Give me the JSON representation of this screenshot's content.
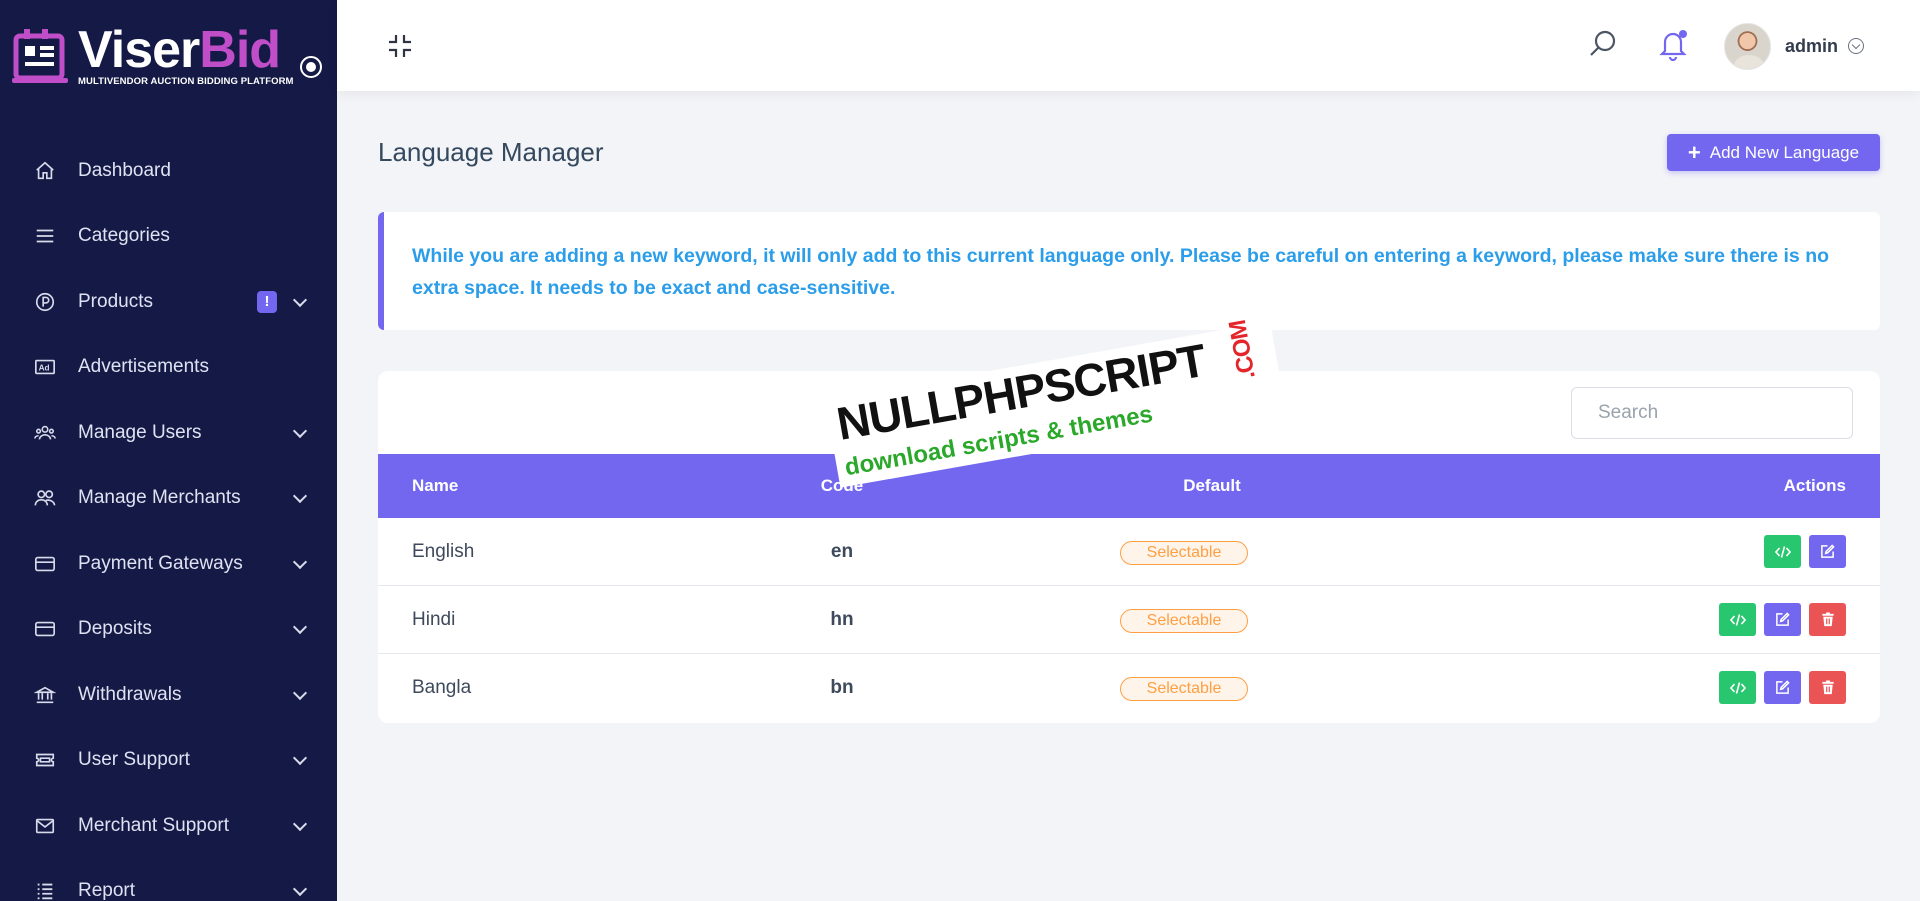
{
  "brand": {
    "name_part1": "Viser",
    "name_part2": "Bid",
    "tagline": "MULTIVENDOR AUCTION BIDDING PLATFORM"
  },
  "sidebar": {
    "items": [
      {
        "label": "Dashboard",
        "icon": "home-icon"
      },
      {
        "label": "Categories",
        "icon": "menu-lines-icon"
      },
      {
        "label": "Products",
        "icon": "p-circle-icon",
        "badge": "!"
      },
      {
        "label": "Advertisements",
        "icon": "ad-icon"
      },
      {
        "label": "Manage Users",
        "icon": "users-icon"
      },
      {
        "label": "Manage Merchants",
        "icon": "merchants-icon"
      },
      {
        "label": "Payment Gateways",
        "icon": "credit-card-icon"
      },
      {
        "label": "Deposits",
        "icon": "credit-card-icon"
      },
      {
        "label": "Withdrawals",
        "icon": "bank-icon"
      },
      {
        "label": "User Support",
        "icon": "ticket-icon"
      },
      {
        "label": "Merchant Support",
        "icon": "mail-icon"
      },
      {
        "label": "Report",
        "icon": "list-icon"
      }
    ]
  },
  "header": {
    "username": "admin"
  },
  "main": {
    "title": "Language Manager",
    "add_button": "Add New Language",
    "alert": "While you are adding a new keyword, it will only add to this current language only. Please be careful on entering a keyword, please make sure there is no extra space. It needs to be exact and case-sensitive.",
    "search_placeholder": "Search",
    "table": {
      "columns": {
        "name": "Name",
        "code": "Code",
        "default": "Default",
        "actions": "Actions"
      },
      "rows": [
        {
          "name": "English",
          "code": "en",
          "default": "Selectable",
          "deletable": false
        },
        {
          "name": "Hindi",
          "code": "hn",
          "default": "Selectable",
          "deletable": true
        },
        {
          "name": "Bangla",
          "code": "bn",
          "default": "Selectable",
          "deletable": true
        }
      ]
    }
  },
  "watermark": {
    "top": "NULLPHPSCRIPT",
    "com": ".COM",
    "bottom": "download scripts & themes"
  },
  "colors": {
    "sidebar_bg": "#141a45",
    "accent": "#7367f0",
    "success": "#28c76f",
    "danger": "#ea5455",
    "warning": "#ff9f43",
    "info_text": "#2b9de9"
  }
}
